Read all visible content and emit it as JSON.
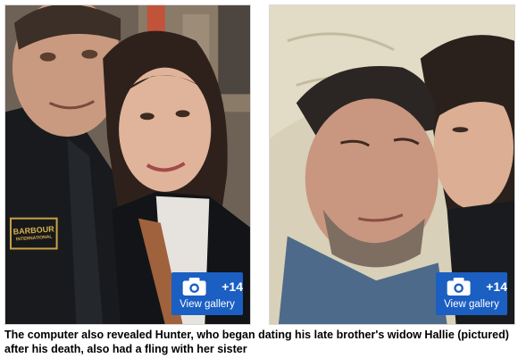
{
  "photos": [
    {
      "gallery": {
        "count": "+14",
        "label": "View gallery"
      },
      "jacket_patch": {
        "brand": "BARBOUR",
        "sub": "INTERNATIONAL"
      }
    },
    {
      "gallery": {
        "count": "+14",
        "label": "View gallery"
      }
    }
  ],
  "caption": {
    "text": "The computer also revealed Hunter, who began dating his late brother's widow Hallie (pictured) after his death, also had a fling with her sister"
  },
  "colors": {
    "gallery_button": "#1b5fc2",
    "caption_text": "#000000"
  },
  "icons": {
    "gallery_button": "camera-icon"
  }
}
